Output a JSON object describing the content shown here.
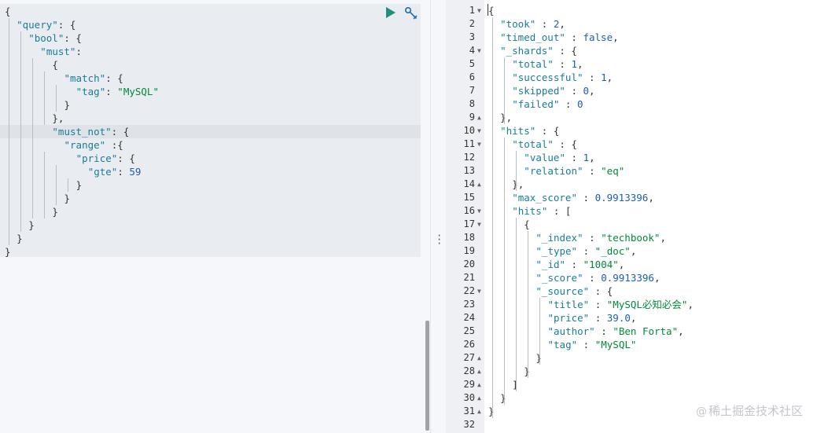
{
  "request": {
    "lines": [
      "{",
      "  \"query\": {",
      "    \"bool\": {",
      "      \"must\":",
      "        {",
      "          \"match\": {",
      "            \"tag\": \"MySQL\"",
      "          }",
      "        },",
      "        \"must_not\": {",
      "          \"range\" :{",
      "            \"price\": {",
      "              \"gte\": 59",
      "            }",
      "          }",
      "        }",
      "    }",
      "  }",
      "}"
    ],
    "active_line": 10
  },
  "toolbar": {
    "run_icon": "play-icon",
    "settings_icon": "wrench-icon",
    "accent_color": "#1f8f7a"
  },
  "response": {
    "lines": [
      "{",
      "  \"took\" : 2,",
      "  \"timed_out\" : false,",
      "  \"_shards\" : {",
      "    \"total\" : 1,",
      "    \"successful\" : 1,",
      "    \"skipped\" : 0,",
      "    \"failed\" : 0",
      "  },",
      "  \"hits\" : {",
      "    \"total\" : {",
      "      \"value\" : 1,",
      "      \"relation\" : \"eq\"",
      "    },",
      "    \"max_score\" : 0.9913396,",
      "    \"hits\" : [",
      "      {",
      "        \"_index\" : \"techbook\",",
      "        \"_type\" : \"_doc\",",
      "        \"_id\" : \"1004\",",
      "        \"_score\" : 0.9913396,",
      "        \"_source\" : {",
      "          \"title\" : \"MySQL必知必会\",",
      "          \"price\" : 39.0,",
      "          \"author\" : \"Ben Forta\",",
      "          \"tag\" : \"MySQL\"",
      "        }",
      "      }",
      "    ]",
      "  }",
      "}",
      ""
    ],
    "line_numbers": [
      "1",
      "2",
      "3",
      "4",
      "5",
      "6",
      "7",
      "8",
      "9",
      "10",
      "11",
      "12",
      "13",
      "14",
      "15",
      "16",
      "17",
      "18",
      "19",
      "20",
      "21",
      "22",
      "23",
      "24",
      "25",
      "26",
      "27",
      "28",
      "29",
      "30",
      "31",
      "32"
    ],
    "fold_down_lines": [
      1,
      4,
      10,
      11,
      16,
      17,
      22
    ],
    "fold_up_lines": [
      9,
      14,
      27,
      28,
      29,
      30,
      31
    ]
  },
  "watermark": {
    "at": "@",
    "text": "稀土掘金技术社区"
  }
}
